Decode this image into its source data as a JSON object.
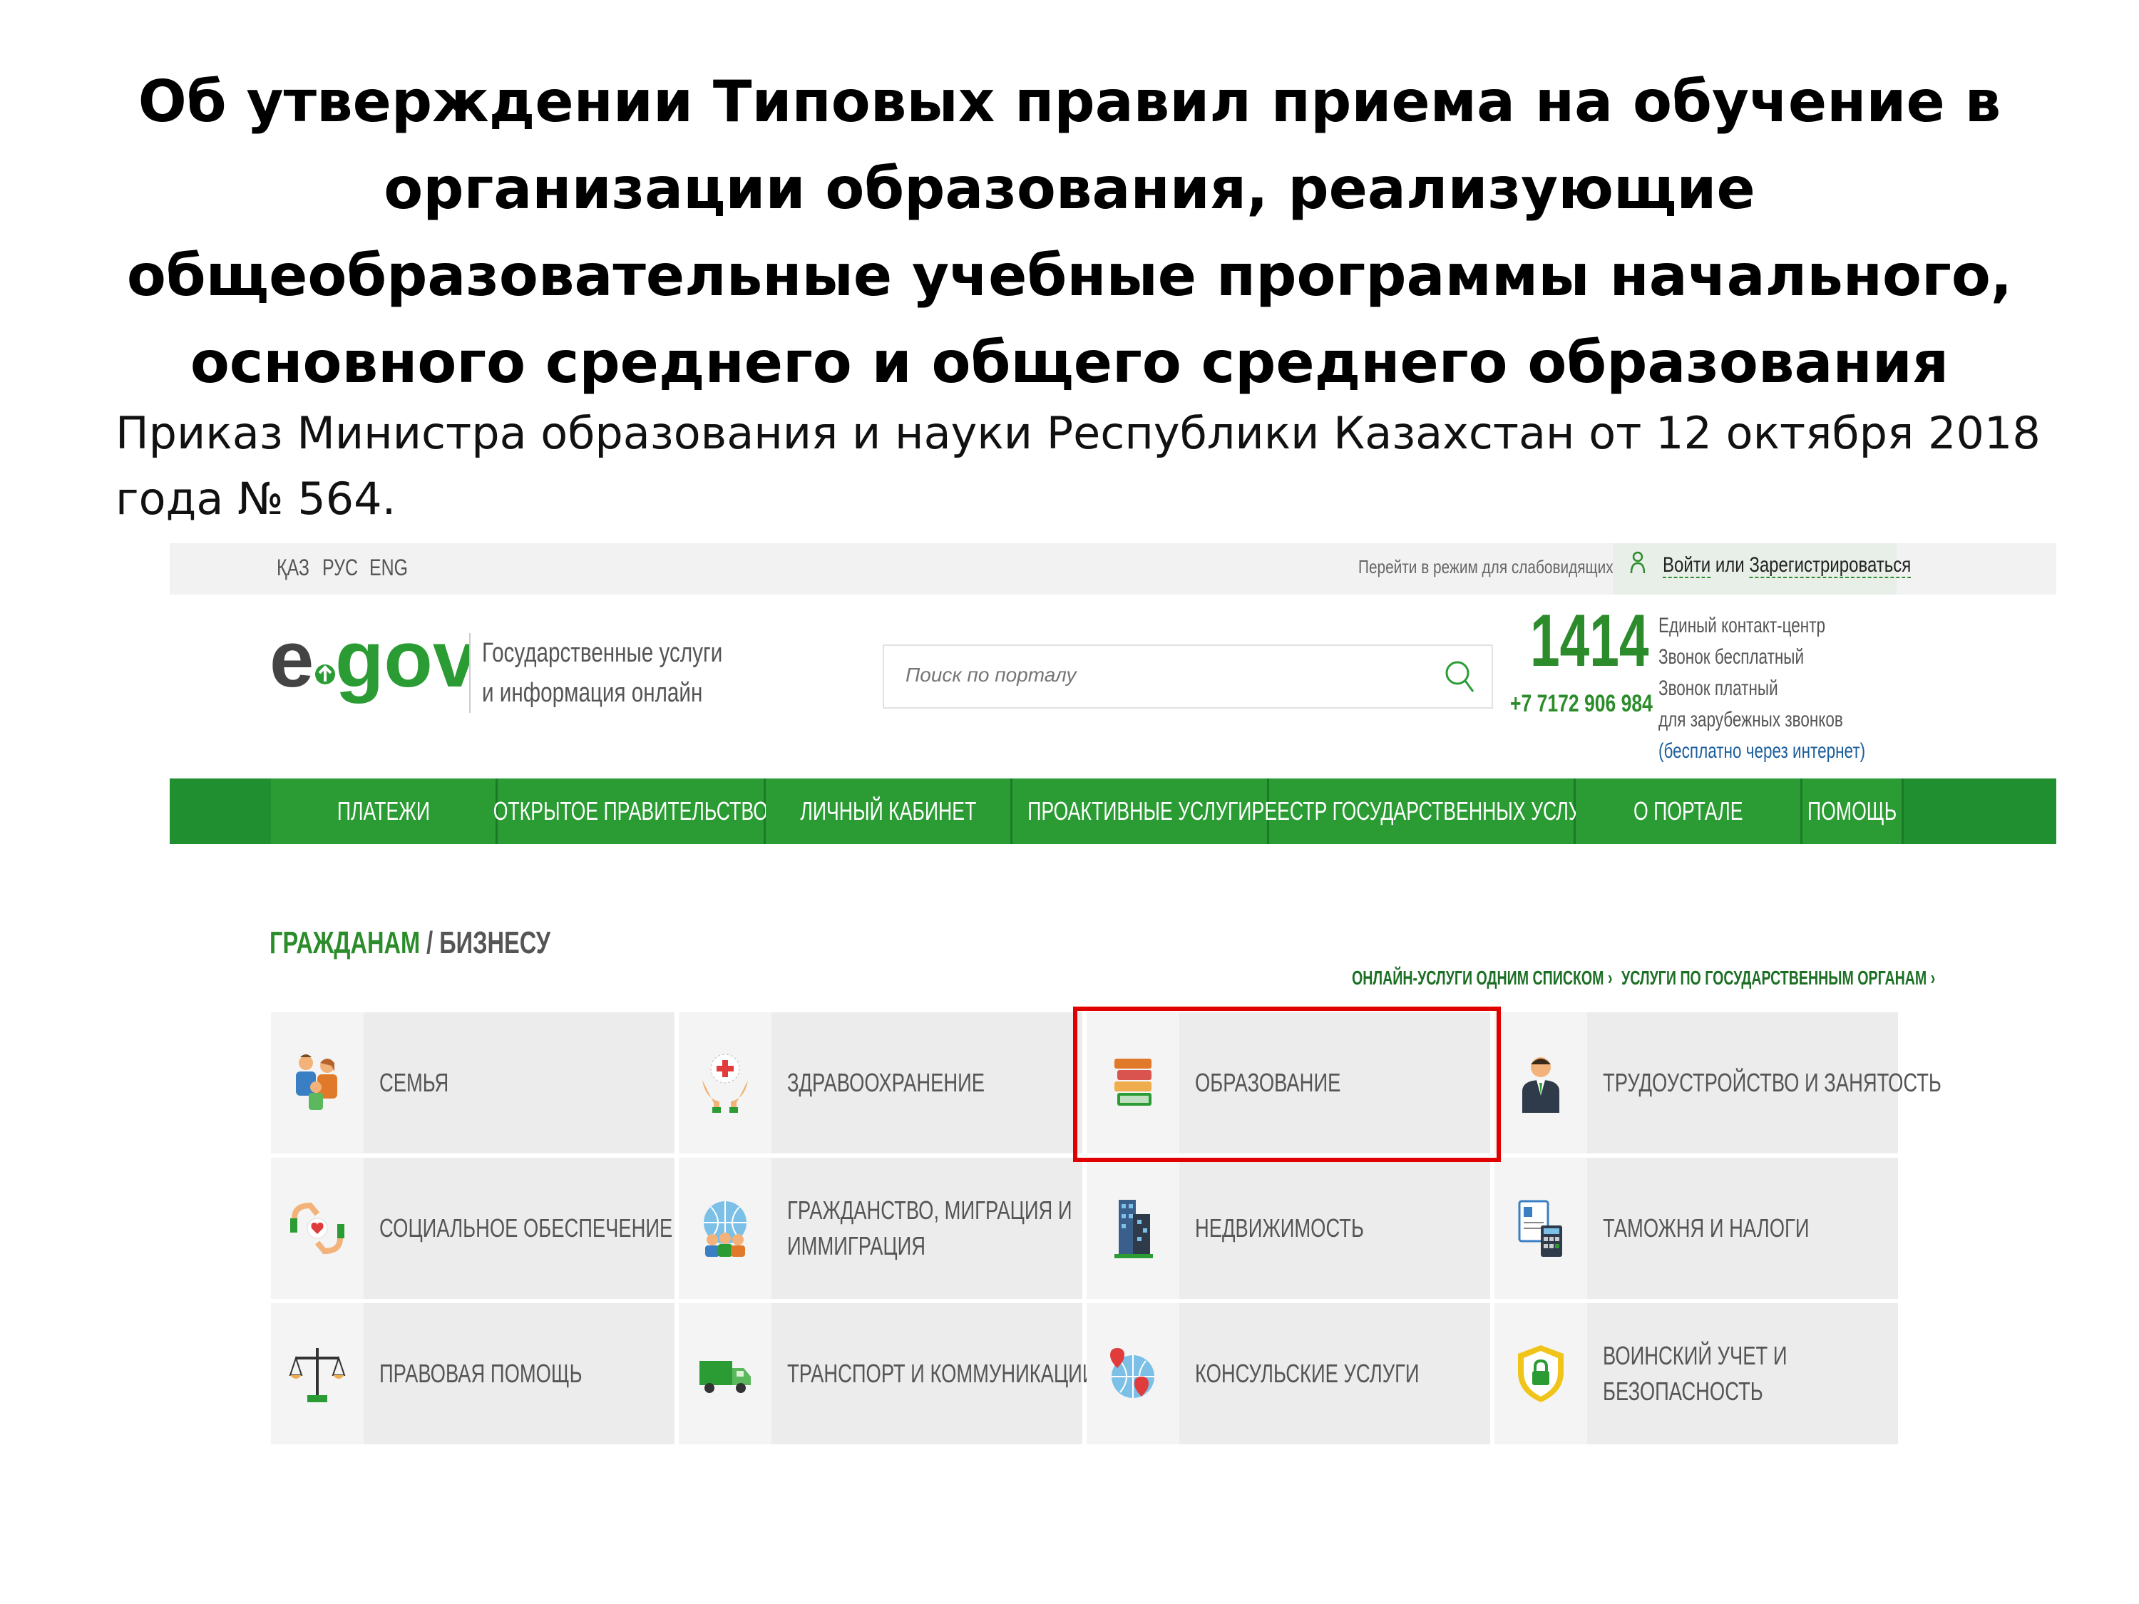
{
  "slide": {
    "title_lines": [
      "Об утверждении Типовых правил приема на обучение в",
      "организации образования, реализующие",
      "общеобразовательные учебные программы начального,",
      "основного среднего и общего среднего образования"
    ],
    "subtitle_lines": [
      "Приказ Министра образования и науки Республики Казахстан от 12 октября 2018",
      "года № 564."
    ]
  },
  "topbar": {
    "languages": [
      "ҚАЗ",
      "РУС",
      "ENG"
    ],
    "accessibility_link": "Перейти в режим для слабовидящих",
    "login_label": "Войти",
    "login_or": "или",
    "register_label": "Зарегистрироваться"
  },
  "header": {
    "logo_text": "egov",
    "tagline_lines": [
      "Государственные услуги",
      "и информация онлайн"
    ],
    "search_placeholder": "Поиск по порталу",
    "hotline_number": "1414",
    "hotline_phone": "+7 7172 906 984",
    "contact_lines": [
      "Единый контакт-центр",
      "Звонок бесплатный",
      "Звонок платный",
      "для зарубежных звонков",
      "(бесплатно через интернет)"
    ]
  },
  "nav": {
    "items": [
      "ПЛАТЕЖИ",
      "ОТКРЫТОЕ ПРАВИТЕЛЬСТВО",
      "ЛИЧНЫЙ КАБИНЕТ",
      "ПРОАКТИВНЫЕ УСЛУГИ",
      "РЕЕСТР ГОСУДАРСТВЕННЫХ УСЛУГ",
      "О ПОРТАЛЕ",
      "ПОМОЩЬ"
    ]
  },
  "section": {
    "title_primary": "ГРАЖДАНАМ",
    "title_separator": " / ",
    "title_secondary": "БИЗНЕСУ",
    "link_online_list": "ОНЛАЙН-УСЛУГИ ОДНИМ СПИСКОМ ›",
    "link_by_agency": "УСЛУГИ ПО ГОСУДАРСТВЕННЫМ ОРГАНАМ ›"
  },
  "tiles": [
    {
      "lines": [
        "СЕМЬЯ"
      ],
      "icon": "family-icon"
    },
    {
      "lines": [
        "ЗДРАВООХРАНЕНИЕ"
      ],
      "icon": "healthcare-icon"
    },
    {
      "lines": [
        "ОБРАЗОВАНИЕ"
      ],
      "icon": "books-icon",
      "highlighted": true
    },
    {
      "lines": [
        "ТРУДОУСТРОЙСТВО И ЗАНЯТОСТЬ"
      ],
      "icon": "employee-icon"
    },
    {
      "lines": [
        "СОЦИАЛЬНОЕ ОБЕСПЕЧЕНИЕ"
      ],
      "icon": "social-care-icon"
    },
    {
      "lines": [
        "ГРАЖДАНСТВО, МИГРАЦИЯ И",
        "ИММИГРАЦИЯ"
      ],
      "icon": "globe-people-icon"
    },
    {
      "lines": [
        "НЕДВИЖИМОСТЬ"
      ],
      "icon": "buildings-icon"
    },
    {
      "lines": [
        "ТАМОЖНЯ И НАЛОГИ"
      ],
      "icon": "customs-calculator-icon"
    },
    {
      "lines": [
        "ПРАВОВАЯ ПОМОЩЬ"
      ],
      "icon": "scales-icon"
    },
    {
      "lines": [
        "ТРАНСПОРТ И КОММУНИКАЦИИ"
      ],
      "icon": "truck-icon"
    },
    {
      "lines": [
        "КОНСУЛЬСКИЕ УСЛУГИ"
      ],
      "icon": "globe-pin-icon"
    },
    {
      "lines": [
        "ВОИНСКИЙ УЧЕТ И",
        "БЕЗОПАСНОСТЬ"
      ],
      "icon": "shield-lock-icon"
    }
  ],
  "colors": {
    "brand_green": "#2a9c33",
    "highlight_red": "#e00000"
  }
}
